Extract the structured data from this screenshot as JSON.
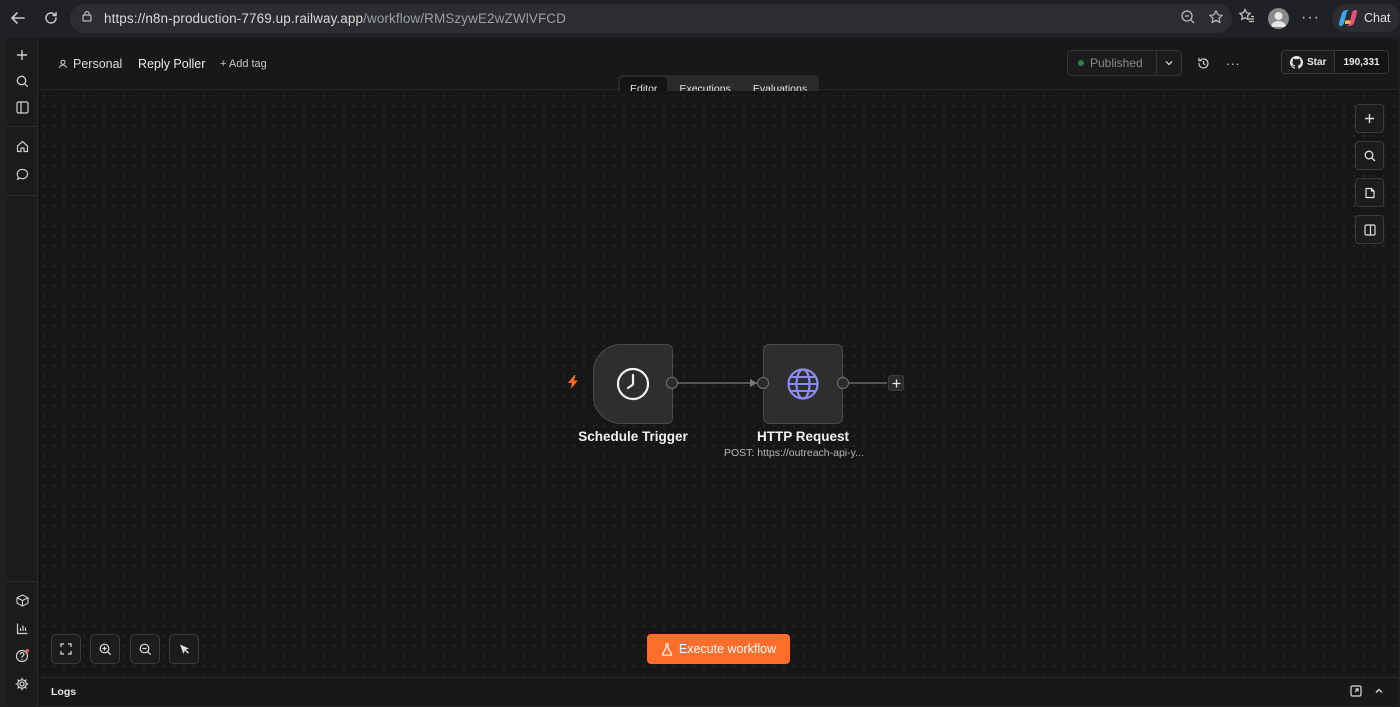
{
  "browser": {
    "url_host": "https://n8n-production-7769.up.railway.app",
    "url_path": "/workflow/RMSzywE2wZWlVFCD",
    "chat_label": "Chat"
  },
  "header": {
    "project_label": "Personal",
    "workflow_name": "Reply Poller",
    "add_tag_label": "+ Add tag",
    "publish_label": "Published",
    "github_star_label": "Star",
    "github_star_count": "190,331"
  },
  "tabs": [
    {
      "label": "Editor",
      "active": true
    },
    {
      "label": "Executions",
      "active": false
    },
    {
      "label": "Evaluations",
      "active": false
    }
  ],
  "nodes": [
    {
      "name": "Schedule Trigger",
      "subtitle": "",
      "icon": "clock-icon"
    },
    {
      "name": "HTTP Request",
      "subtitle": "POST: https://outreach-api-y...",
      "icon": "globe-icon"
    }
  ],
  "execute_label": "Execute workflow",
  "logs_label": "Logs",
  "colors": {
    "accent": "#ff6d2a",
    "trigger_bolt": "#ff6d2a",
    "globe": "#8b8cf0",
    "published_dot": "#2f7d4a"
  }
}
